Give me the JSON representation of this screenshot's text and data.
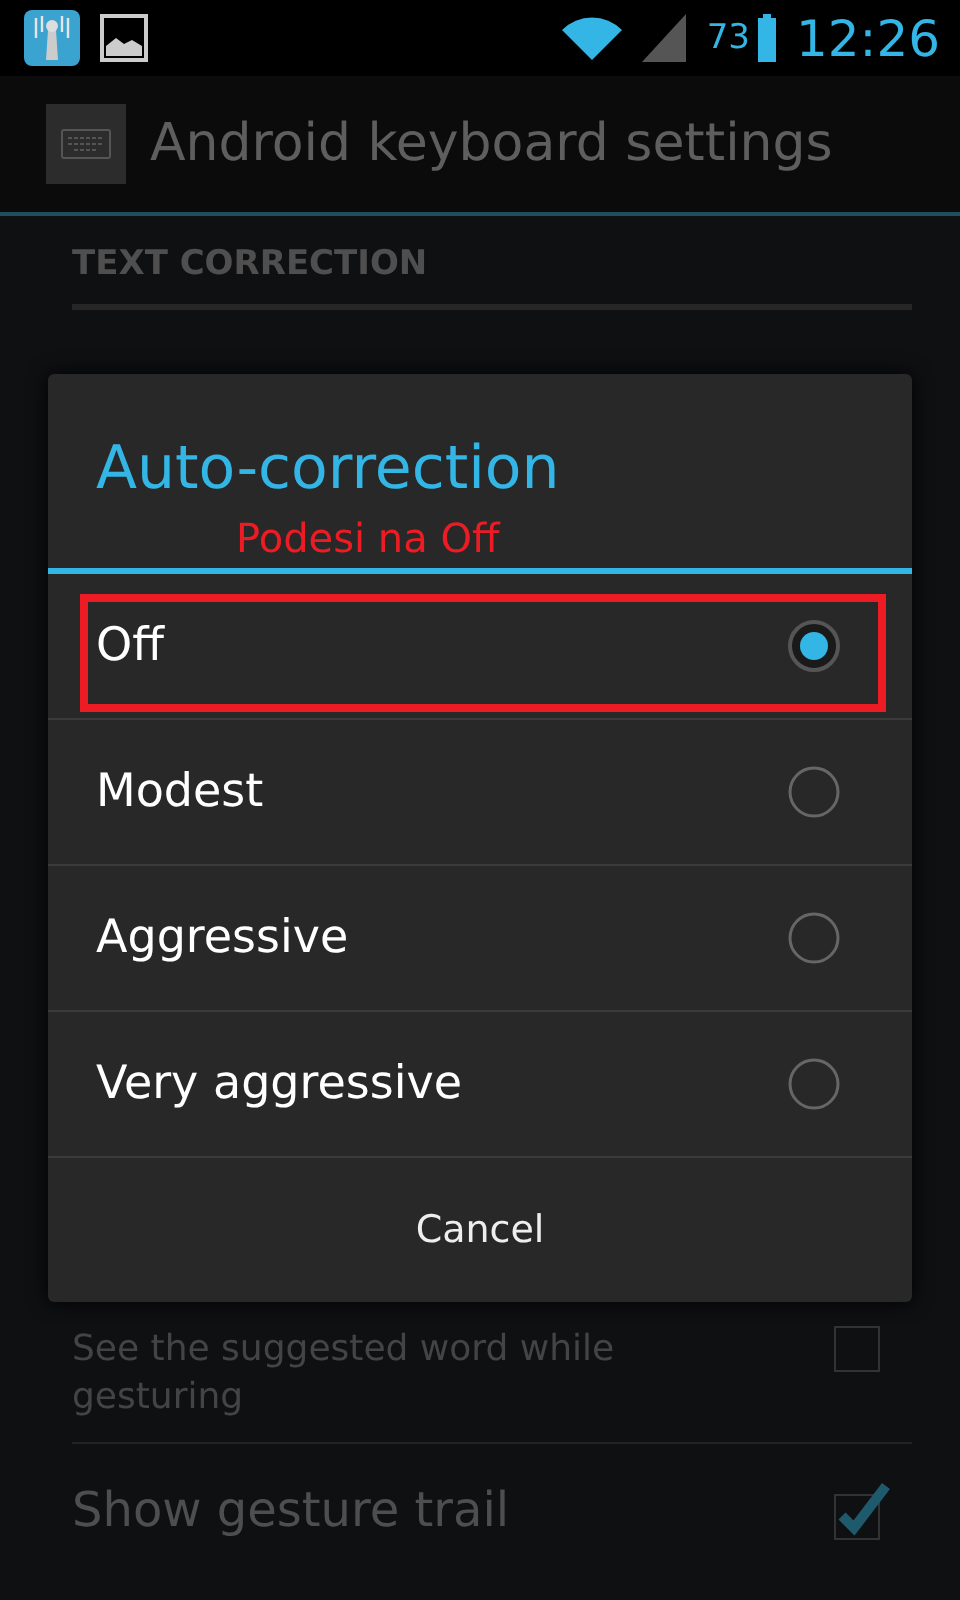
{
  "status_bar": {
    "battery": "73",
    "time": "12:26"
  },
  "action_bar": {
    "title": "Android keyboard settings"
  },
  "section": {
    "header": "TEXT CORRECTION"
  },
  "preferences": [
    {
      "summary": "See the suggested word while gesturing",
      "checked": false
    },
    {
      "title": "Show gesture trail",
      "checked": true
    }
  ],
  "dialog": {
    "title": "Auto-correction",
    "annotation": "Podesi na Off",
    "options": [
      {
        "label": "Off",
        "selected": true,
        "highlighted": true
      },
      {
        "label": "Modest",
        "selected": false,
        "highlighted": false
      },
      {
        "label": "Aggressive",
        "selected": false,
        "highlighted": false
      },
      {
        "label": "Very aggressive",
        "selected": false,
        "highlighted": false
      }
    ],
    "cancel": "Cancel"
  }
}
